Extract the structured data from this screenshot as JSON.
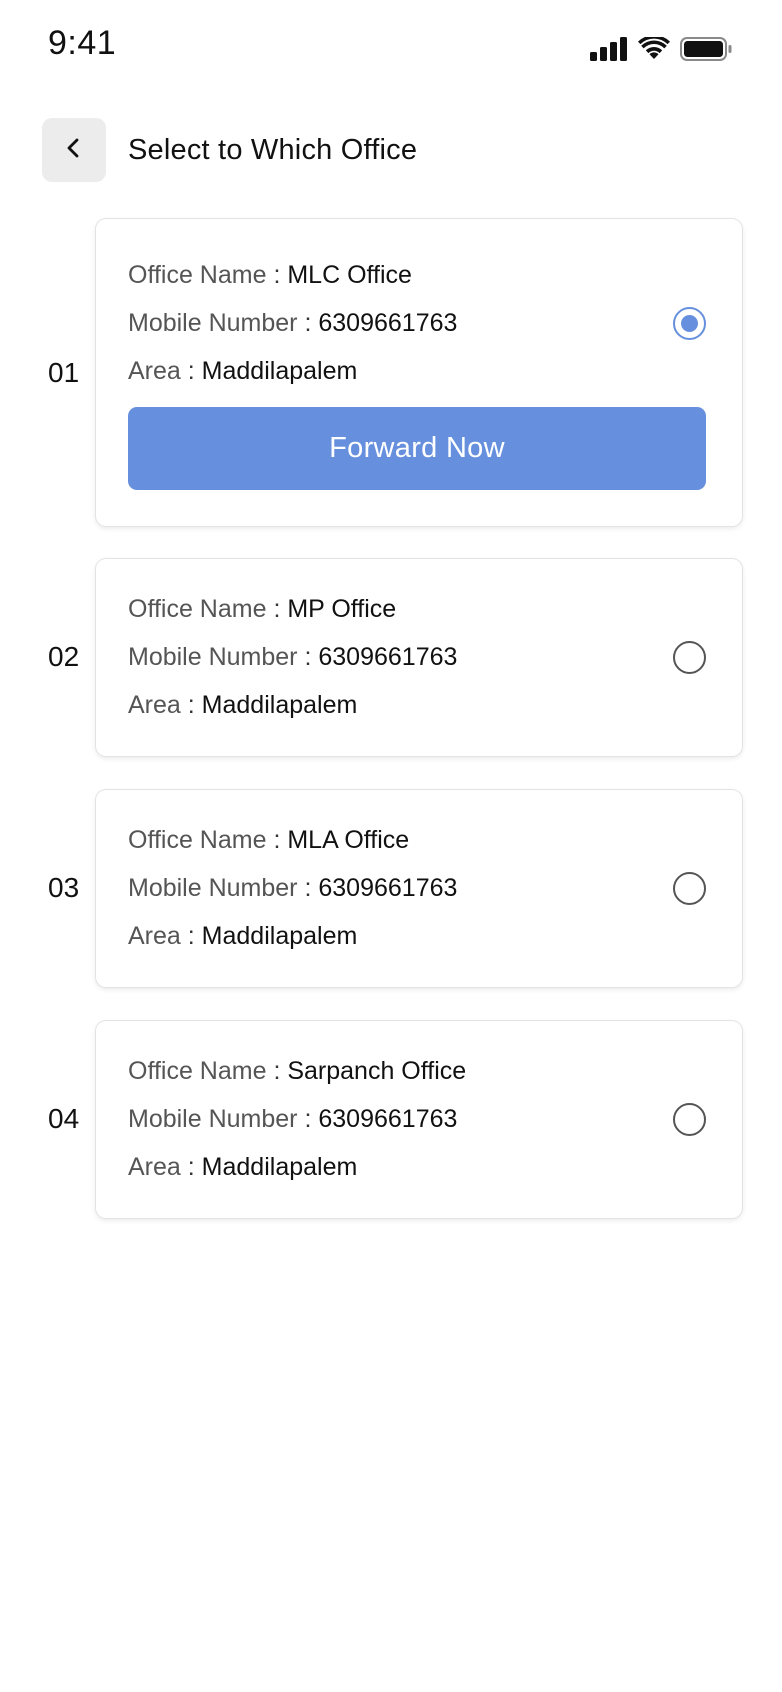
{
  "status_bar": {
    "time": "9:41",
    "icons": [
      "cellular-signal-icon",
      "wifi-icon",
      "battery-icon"
    ]
  },
  "header": {
    "back_icon": "chevron-left-icon",
    "title": "Select to Which Office"
  },
  "labels": {
    "office_name": "Office Name",
    "mobile_number": "Mobile Number",
    "area": "Area",
    "separator": ":"
  },
  "offices": [
    {
      "index": "01",
      "office_name": "MLC Office",
      "mobile_number": "6309661763",
      "area": "Maddilapalem",
      "selected": true
    },
    {
      "index": "02",
      "office_name": "MP Office",
      "mobile_number": "6309661763",
      "area": "Maddilapalem",
      "selected": false
    },
    {
      "index": "03",
      "office_name": "MLA Office",
      "mobile_number": "6309661763",
      "area": "Maddilapalem",
      "selected": false
    },
    {
      "index": "04",
      "office_name": "Sarpanch Office",
      "mobile_number": "6309661763",
      "area": "Maddilapalem",
      "selected": false
    }
  ],
  "forward_button": {
    "label": "Forward Now"
  },
  "colors": {
    "accent": "#6690de",
    "back_button_bg": "#ececec",
    "card_border": "#e3e3e3"
  }
}
